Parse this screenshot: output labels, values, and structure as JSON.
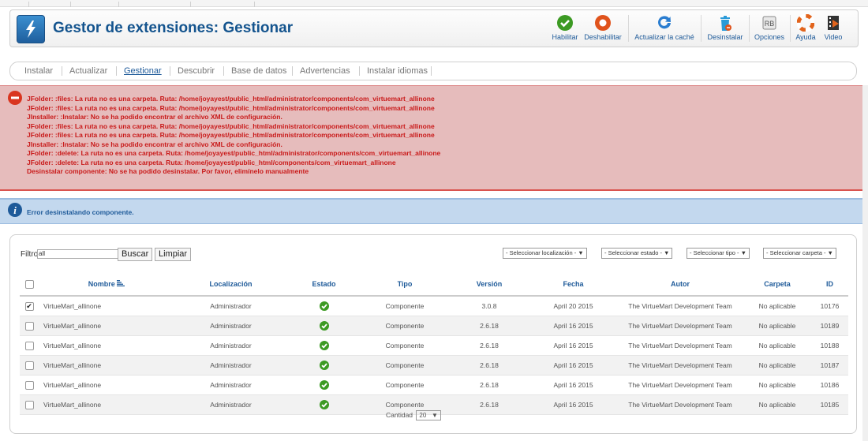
{
  "header": {
    "title": "Gestor de extensiones: Gestionar",
    "buttons": [
      {
        "id": "enable",
        "label": "Habilitar",
        "icon": "check-circle-icon",
        "color": "#3c9a23"
      },
      {
        "id": "disable",
        "label": "Deshabilitar",
        "icon": "stop-circle-icon",
        "color": "#e0531c"
      },
      {
        "id": "refresh",
        "label": "Actualizar la caché",
        "icon": "refresh-icon",
        "color": "#2a7dd0"
      },
      {
        "id": "uninstall",
        "label": "Desinstalar",
        "icon": "trash-icon",
        "color": "#2a9ad8"
      },
      {
        "id": "options",
        "label": "Opciones",
        "icon": "options-icon",
        "color": "#777777"
      },
      {
        "id": "help",
        "label": "Ayuda",
        "icon": "lifebuoy-icon",
        "color": "#e2641c"
      },
      {
        "id": "video",
        "label": "Video",
        "icon": "film-icon",
        "color": "#333333"
      }
    ]
  },
  "subnav": {
    "items": [
      "Instalar",
      "Actualizar",
      "Gestionar",
      "Descubrir",
      "Base de datos",
      "Advertencias",
      "Instalar idiomas"
    ],
    "active": "Gestionar"
  },
  "alert_error": {
    "messages": [
      "JFolder: :files: La ruta no es una carpeta. Ruta: /home/joyayest/public_html/administrator/components/com_virtuemart_allinone",
      "JFolder: :files: La ruta no es una carpeta. Ruta: /home/joyayest/public_html/administrator/components/com_virtuemart_allinone",
      "JInstaller: :Instalar: No se ha podido encontrar el archivo XML de configuración.",
      "JFolder: :files: La ruta no es una carpeta. Ruta: /home/joyayest/public_html/administrator/components/com_virtuemart_allinone",
      "JFolder: :files: La ruta no es una carpeta. Ruta: /home/joyayest/public_html/administrator/components/com_virtuemart_allinone",
      "JInstaller: :Instalar: No se ha podido encontrar el archivo XML de configuración.",
      "JFolder: :delete: La ruta no es una carpeta. Ruta: /home/joyayest/public_html/administrator/components/com_virtuemart_allinone",
      "JFolder: :delete: La ruta no es una carpeta. Ruta: /home/joyayest/public_html/components/com_virtuemart_allinone",
      "Desinstalar componente: No se ha podido desinstalar. Por favor, elimínelo manualmente"
    ]
  },
  "alert_info": {
    "message": "Error desinstalando componente."
  },
  "filters": {
    "filter_label": "Filtro:",
    "filter_value": "all",
    "search_label": "Buscar",
    "clear_label": "Limpiar",
    "selects": [
      "- Seleccionar localización -",
      "- Seleccionar estado -",
      "- Seleccionar tipo -",
      "- Seleccionar carpeta -"
    ]
  },
  "table": {
    "headers": [
      "Nombre",
      "Localización",
      "Estado",
      "Tipo",
      "Versión",
      "Fecha",
      "Autor",
      "Carpeta",
      "ID"
    ],
    "rows": [
      {
        "checked": true,
        "name": "VirtueMart_allinone",
        "location": "Administrador",
        "type": "Componente",
        "version": "3.0.8",
        "date": "April 20 2015",
        "author": "The VirtueMart Development Team",
        "folder": "No aplicable",
        "id": "10176"
      },
      {
        "checked": false,
        "name": "VirtueMart_allinone",
        "location": "Administrador",
        "type": "Componente",
        "version": "2.6.18",
        "date": "April 16 2015",
        "author": "The VirtueMart Development Team",
        "folder": "No aplicable",
        "id": "10189"
      },
      {
        "checked": false,
        "name": "VirtueMart_allinone",
        "location": "Administrador",
        "type": "Componente",
        "version": "2.6.18",
        "date": "April 16 2015",
        "author": "The VirtueMart Development Team",
        "folder": "No aplicable",
        "id": "10188"
      },
      {
        "checked": false,
        "name": "VirtueMart_allinone",
        "location": "Administrador",
        "type": "Componente",
        "version": "2.6.18",
        "date": "April 16 2015",
        "author": "The VirtueMart Development Team",
        "folder": "No aplicable",
        "id": "10187"
      },
      {
        "checked": false,
        "name": "VirtueMart_allinone",
        "location": "Administrador",
        "type": "Componente",
        "version": "2.6.18",
        "date": "April 16 2015",
        "author": "The VirtueMart Development Team",
        "folder": "No aplicable",
        "id": "10186"
      },
      {
        "checked": false,
        "name": "VirtueMart_allinone",
        "location": "Administrador",
        "type": "Componente",
        "version": "2.6.18",
        "date": "April 16 2015",
        "author": "The VirtueMart Development Team",
        "folder": "No aplicable",
        "id": "10185"
      }
    ]
  },
  "pager": {
    "label": "Cantidad",
    "value": "20"
  }
}
